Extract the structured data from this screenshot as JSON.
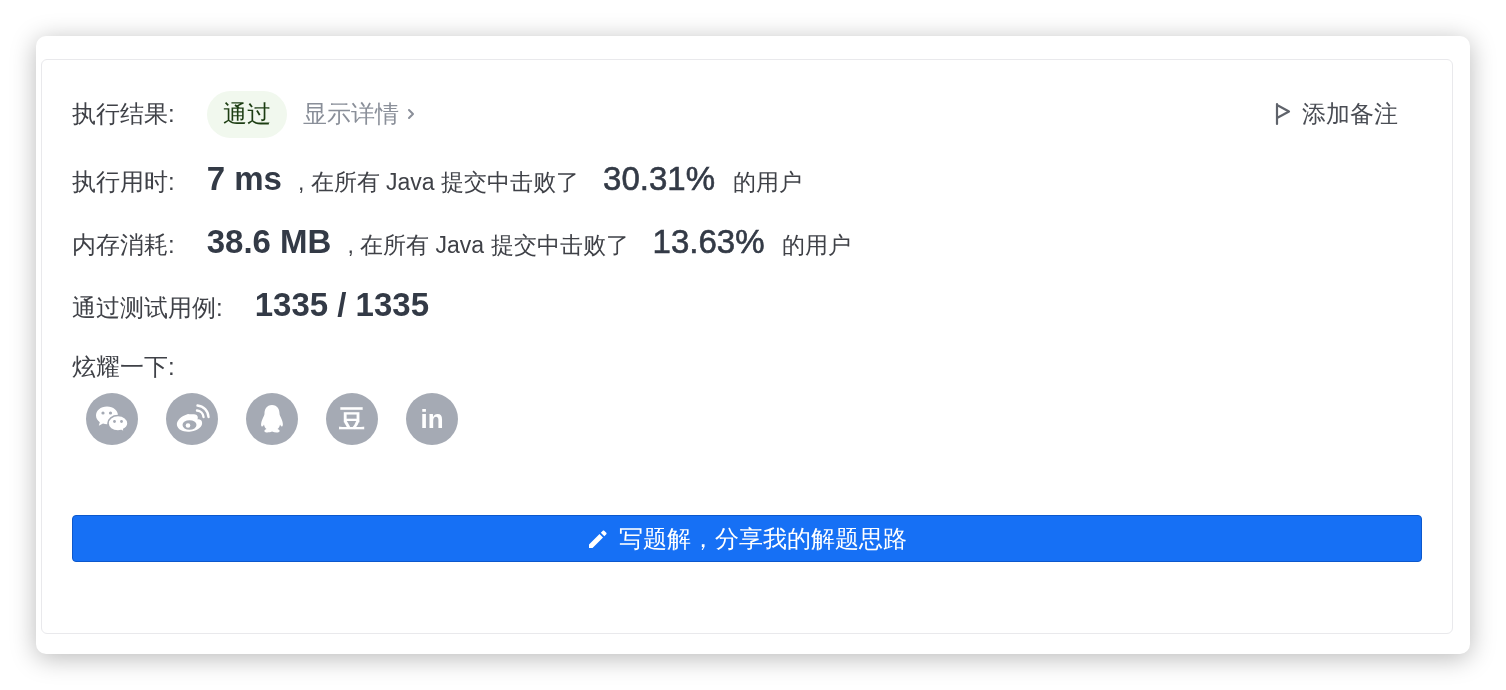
{
  "result": {
    "label": "执行结果:",
    "status": "通过",
    "details_link": "显示详情",
    "note_button": "添加备注"
  },
  "stats": [
    {
      "label": "执行用时:",
      "value": "7 ms",
      "comparison": ", 在所有 Java 提交中击败了",
      "percentile": "30.31%",
      "suffix": "的用户"
    },
    {
      "label": "内存消耗:",
      "value": "38.6 MB",
      "comparison": ", 在所有 Java 提交中击败了",
      "percentile": "13.63%",
      "suffix": "的用户"
    }
  ],
  "test_cases": {
    "label": "通过测试用例:",
    "value": "1335 / 1335"
  },
  "share": {
    "label": "炫耀一下:",
    "targets": [
      {
        "kind": "bubbles"
      },
      {
        "kind": "swirl"
      },
      {
        "kind": "penguin"
      },
      {
        "kind": "glyph",
        "text": "豆"
      },
      {
        "kind": "glyph",
        "text": "in"
      }
    ]
  },
  "solution_button": "写题解，分享我的解题思路"
}
